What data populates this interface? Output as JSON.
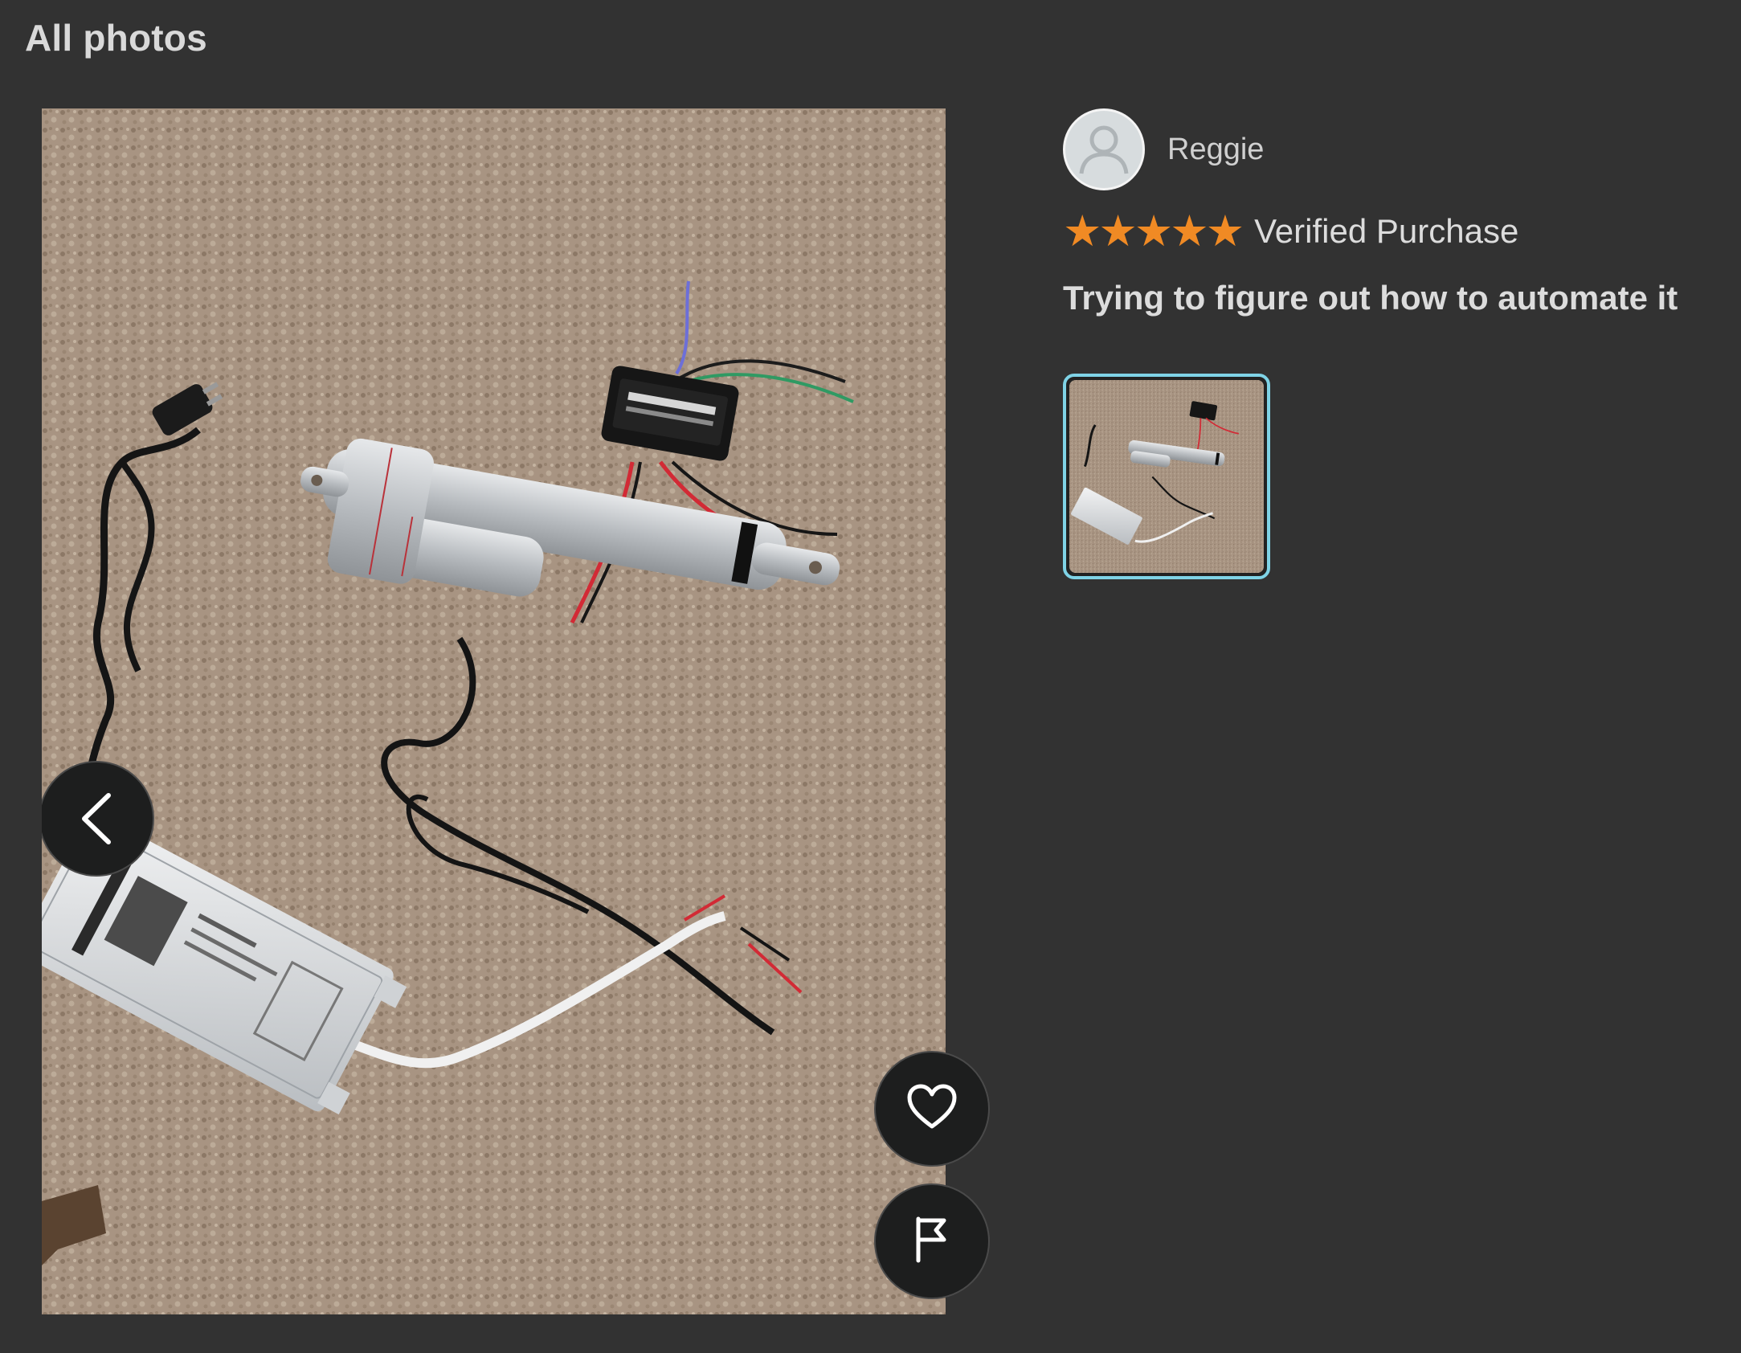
{
  "header": {
    "title": "All photos"
  },
  "review": {
    "reviewer_name": "Reggie",
    "rating": 5,
    "rating_max": 5,
    "stars": [
      "★",
      "★",
      "★",
      "★",
      "★"
    ],
    "verified_label": "Verified Purchase",
    "title": "Trying to figure out how to automate it"
  },
  "colors": {
    "background": "#323232",
    "star": "#f08a24",
    "thumb_selected_border": "#7fd3e6"
  },
  "icons": {
    "prev": "chevron-left-icon",
    "like": "heart-icon",
    "report": "flag-icon",
    "avatar": "user-silhouette-icon"
  }
}
